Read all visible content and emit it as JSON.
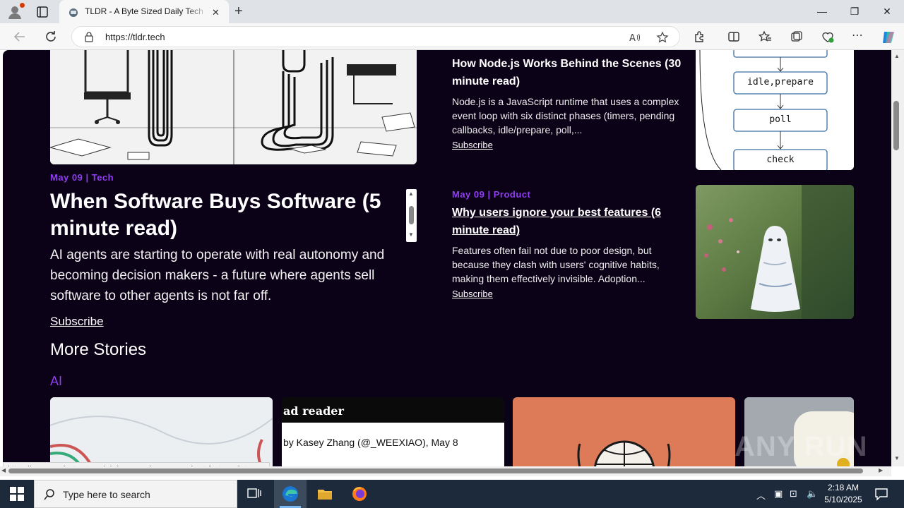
{
  "browser": {
    "tab_title": "TLDR - A Byte Sized Daily Tech Newsletter",
    "url": "https://tldr.tech",
    "status_url": "https://www.productparty.us/p/why-users-ignore-your-best-features?utm_..."
  },
  "hero": {
    "meta": "May 09  |  Tech",
    "title": "When Software Buys Software (5 minute read)",
    "description": "AI agents are starting to operate with real autonomy and becoming decision makers - a future where agents sell software to other agents is not far off.",
    "subscribe": "Subscribe"
  },
  "cards": [
    {
      "title": "How Node.js Works Behind the Scenes (30 minute read)",
      "description": "Node.js is a JavaScript runtime that uses a complex event loop with six distinct phases (timers, pending callbacks, idle/prepare, poll,...",
      "subscribe": "Subscribe"
    },
    {
      "meta": "May 09  |  Product",
      "title": "Why users ignore your best features (6 minute read)",
      "description": "Features often fail not due to poor design, but because they clash with users' cognitive habits, making them effectively invisible. Adoption...",
      "subscribe": "Subscribe"
    }
  ],
  "diagram": {
    "boxes": [
      "idle,prepare",
      "poll",
      "check"
    ]
  },
  "sections": {
    "more_stories": "More Stories",
    "ai_label": "AI"
  },
  "thumbs": {
    "reader_title": "ad reader",
    "reader_byline": "by Kasey Zhang (@_WEEXIAO), May 8"
  },
  "watermark": "ANY RUN",
  "taskbar": {
    "search_placeholder": "Type here to search",
    "time": "2:18 AM",
    "date": "5/10/2025"
  },
  "colors": {
    "page_bg": "#0c0218",
    "accent": "#8f3df0"
  }
}
